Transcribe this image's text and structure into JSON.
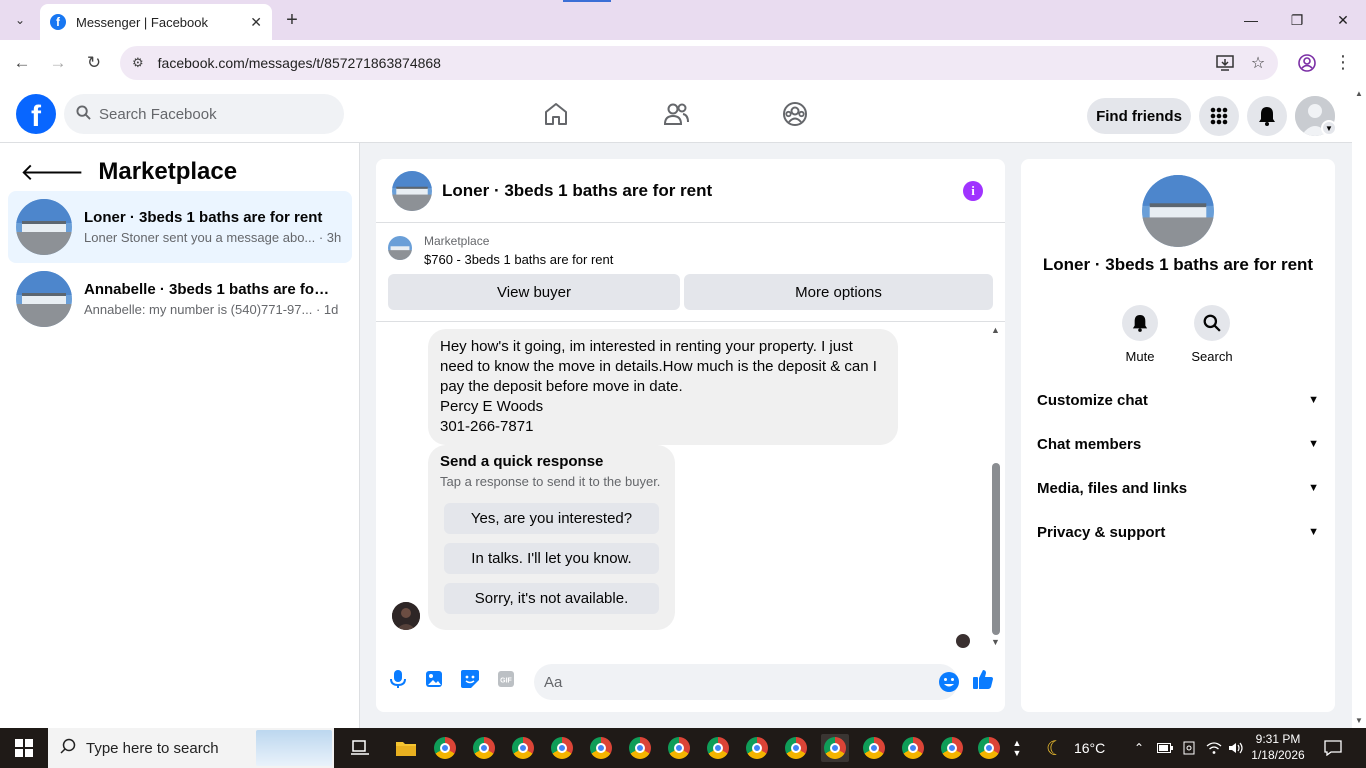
{
  "browser": {
    "tab_title": "Messenger | Facebook",
    "url": "facebook.com/messages/t/857271863874868"
  },
  "header": {
    "search_placeholder": "Search Facebook",
    "find_friends": "Find friends"
  },
  "left_panel": {
    "title": "Marketplace",
    "conversations": [
      {
        "name": "Loner · 3beds 1 baths are for rent",
        "preview": "Loner Stoner sent you a message abo... · 3h",
        "active": true
      },
      {
        "name": "Annabelle · 3beds 1 baths are for r...",
        "preview": "Annabelle: my number is (540)771-97... · 1d",
        "active": false
      }
    ]
  },
  "chat": {
    "title": "Loner · 3beds 1 baths are for rent",
    "marketplace_label": "Marketplace",
    "listing": "$760 - 3beds 1 baths are for rent",
    "view_buyer": "View buyer",
    "more_options": "More options",
    "message_lines": [
      "Hey how's it going, im interested in renting your property. I just",
      "need to know the move in details.How much is the deposit & can I",
      "pay the deposit before move in date.",
      "Percy E Woods",
      "301-266-7871"
    ],
    "quick_response": {
      "title": "Send a quick response",
      "subtitle": "Tap a response to send it to the buyer.",
      "options": [
        "Yes, are you interested?",
        "In talks. I'll let you know.",
        "Sorry, it's not available."
      ]
    },
    "composer_placeholder": "Aa"
  },
  "info_panel": {
    "name": "Loner · 3beds 1 baths are for rent",
    "mute": "Mute",
    "search": "Search",
    "sections": [
      "Customize chat",
      "Chat members",
      "Media, files and links",
      "Privacy & support"
    ]
  },
  "taskbar": {
    "search_text": "Type here to search",
    "weather": "16°C",
    "time": "9:31 PM",
    "date": "1/18/2026"
  },
  "colors": {
    "fb_blue": "#0866ff",
    "info_purple": "#a033ff",
    "messenger_blue": "#0a7cff"
  }
}
